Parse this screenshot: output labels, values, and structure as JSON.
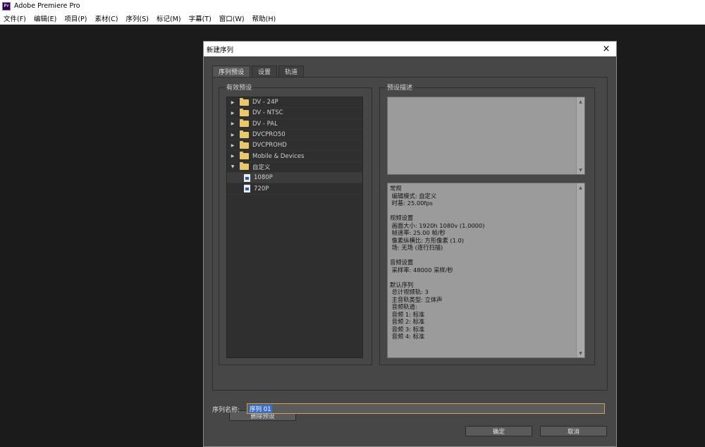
{
  "app": {
    "icon_text": "Pr",
    "title": "Adobe Premiere Pro"
  },
  "menu": [
    "文件(F)",
    "编辑(E)",
    "项目(P)",
    "素材(C)",
    "序列(S)",
    "标记(M)",
    "字幕(T)",
    "窗口(W)",
    "帮助(H)"
  ],
  "dialog": {
    "title": "新建序列",
    "close": "×",
    "tabs": [
      "序列预设",
      "设置",
      "轨道"
    ],
    "presets_label": "有效预设",
    "description_label": "预设描述",
    "presets": [
      {
        "label": "DV - 24P",
        "type": "folder",
        "expanded": false
      },
      {
        "label": "DV - NTSC",
        "type": "folder",
        "expanded": false
      },
      {
        "label": "DV - PAL",
        "type": "folder",
        "expanded": false
      },
      {
        "label": "DVCPRO50",
        "type": "folder",
        "expanded": false
      },
      {
        "label": "DVCPROHD",
        "type": "folder",
        "expanded": false
      },
      {
        "label": "Mobile & Devices",
        "type": "folder",
        "expanded": false
      },
      {
        "label": "自定义",
        "type": "folder",
        "expanded": true
      },
      {
        "label": "1080P",
        "type": "file",
        "selected": true
      },
      {
        "label": "720P",
        "type": "file",
        "selected": false
      }
    ],
    "details": "常规\n 编辑模式: 自定义\n 时基: 25.00fps\n\n视频设置\n 画面大小: 1920h 1080v (1.0000)\n 帧速率: 25.00 帧/秒\n 像素纵横比: 方形像素 (1.0)\n 场: 无场 (逐行扫描)\n\n音频设置\n 采样率: 48000 采样/秒\n\n默认序列\n 总计视频轨: 3\n 主音轨类型: 立体声\n 音频轨道:\n 音频 1: 标准\n 音频 2: 标准\n 音频 3: 标准\n 音频 4: 标准",
    "delete_button": "删除预设",
    "sequence_name_label": "序列名称:",
    "sequence_name_value": "序列 01",
    "ok_button": "确定",
    "cancel_button": "取消"
  }
}
